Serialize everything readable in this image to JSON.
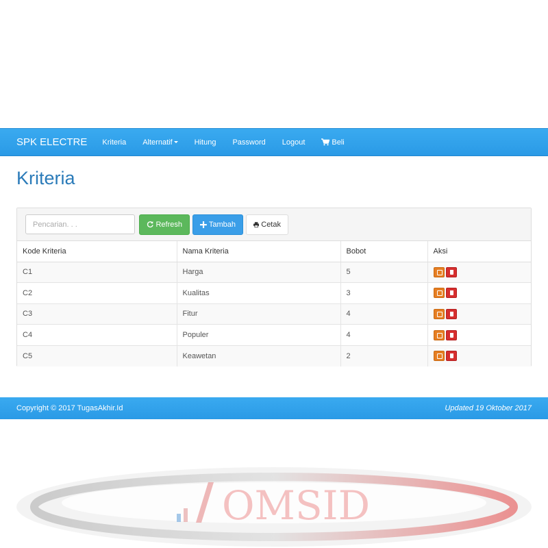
{
  "navbar": {
    "brand": "SPK ELECTRE",
    "items": [
      {
        "label": "Kriteria"
      },
      {
        "label": "Alternatif"
      },
      {
        "label": "Hitung"
      },
      {
        "label": "Password"
      },
      {
        "label": "Logout"
      },
      {
        "label": "Beli",
        "icon": "cart-icon"
      }
    ]
  },
  "page": {
    "title": "Kriteria"
  },
  "toolbar": {
    "search_placeholder": "Pencarian. . .",
    "refresh_label": "Refresh",
    "tambah_label": "Tambah",
    "cetak_label": "Cetak"
  },
  "table": {
    "headers": [
      "Kode Kriteria",
      "Nama Kriteria",
      "Bobot",
      "Aksi"
    ],
    "rows": [
      {
        "kode": "C1",
        "nama": "Harga",
        "bobot": "5"
      },
      {
        "kode": "C2",
        "nama": "Kualitas",
        "bobot": "3"
      },
      {
        "kode": "C3",
        "nama": "Fitur",
        "bobot": "4"
      },
      {
        "kode": "C4",
        "nama": "Populer",
        "bobot": "4"
      },
      {
        "kode": "C5",
        "nama": "Keawetan",
        "bobot": "2"
      }
    ]
  },
  "footer": {
    "copyright": "Copyright © 2017 TugasAkhir.Id",
    "updated": "Updated 19 Oktober 2017"
  },
  "watermark": {
    "text": "OMSID"
  },
  "colors": {
    "navbar": "#2a9ae6",
    "title": "#2b7bb9",
    "success": "#5cb85c",
    "primary": "#3a9ee8",
    "edit": "#e67e22",
    "delete": "#d62f2f"
  }
}
